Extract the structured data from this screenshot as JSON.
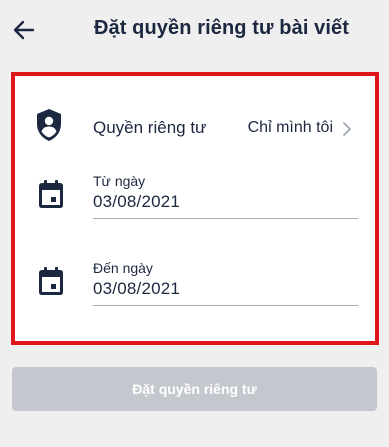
{
  "header": {
    "title": "Đặt quyền riêng tư bài viết",
    "back_icon": "arrow-left-icon"
  },
  "privacy": {
    "label": "Quyền riêng tư",
    "value": "Chỉ mình tôi",
    "icon": "shield-user-icon",
    "chevron_icon": "chevron-right-icon"
  },
  "from_date": {
    "label": "Từ ngày",
    "value": "03/08/2021",
    "icon": "calendar-icon"
  },
  "to_date": {
    "label": "Đến ngày",
    "value": "03/08/2021",
    "icon": "calendar-icon"
  },
  "submit": {
    "label": "Đặt quyền riêng tư"
  },
  "colors": {
    "text": "#1c2740",
    "highlight_border": "#e1161c",
    "button_disabled": "#c4c7ce",
    "background": "#efeff0"
  }
}
